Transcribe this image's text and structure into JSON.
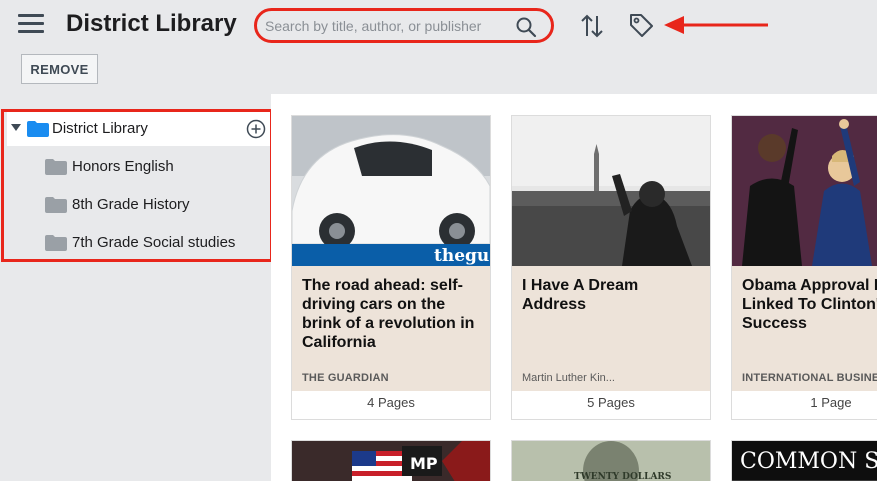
{
  "header": {
    "title": "District Library",
    "search_placeholder": "Search by title, author, or publisher"
  },
  "toolbar": {
    "remove_label": "REMOVE"
  },
  "sidebar": {
    "root": {
      "label": "District Library"
    },
    "items": [
      {
        "label": "Honors English"
      },
      {
        "label": "8th Grade History"
      },
      {
        "label": "7th Grade Social studies"
      }
    ]
  },
  "cards": [
    {
      "title": "The road ahead: self-driving cars on the brink of a revolution in California",
      "source": "THE GUARDIAN",
      "pages": "4 Pages",
      "thumb_text": "theguardian"
    },
    {
      "title": "I Have A Dream Address",
      "source": "Martin Luther Kin...",
      "pages": "5 Pages"
    },
    {
      "title": "Obama Approval Rating Linked To Clinton's Success",
      "source": "INTERNATIONAL BUSINESS",
      "pages": "1 Page"
    }
  ],
  "second_row": [
    {
      "thumb_text": "MP"
    },
    {
      "thumb_text": "TWENTY DOLLARS"
    },
    {
      "thumb_text": "COMMON SE"
    }
  ],
  "colors": {
    "annotation_red": "#e8261b",
    "folder_blue": "#1a8cf0",
    "folder_gray": "#9aa0a6",
    "card_info_bg": "#ede3d9"
  }
}
